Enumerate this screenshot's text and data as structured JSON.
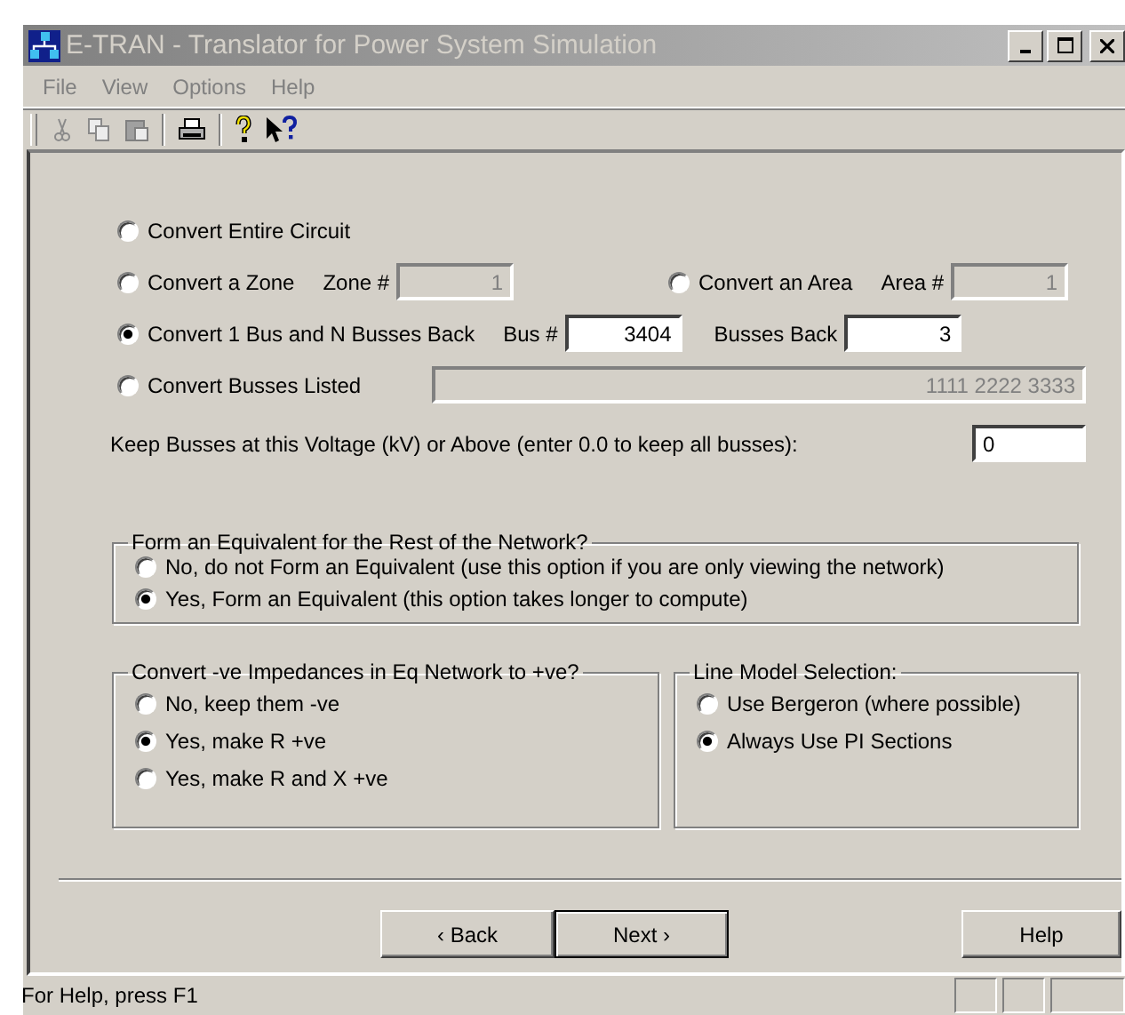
{
  "window": {
    "title": "E-TRAN - Translator for Power System Simulation"
  },
  "menu": [
    {
      "label": "File"
    },
    {
      "label": "View"
    },
    {
      "label": "Options"
    },
    {
      "label": "Help"
    }
  ],
  "conversion_rows": [
    [
      {
        "label": "Convert Entire Circuit",
        "selected": false
      }
    ],
    [
      {
        "label": "Convert a Zone",
        "selected": false,
        "fields": [
          {
            "label": "Zone #",
            "value": "1",
            "disabled": true
          }
        ]
      },
      {
        "label": "Convert an Area",
        "selected": false,
        "fields": [
          {
            "label": "Area #",
            "value": "1",
            "disabled": true
          }
        ]
      }
    ],
    [
      {
        "label": "Convert 1 Bus and N Busses Back",
        "selected": true,
        "fields": [
          {
            "label": "Bus #",
            "value": "3404",
            "disabled": false
          },
          {
            "label": "Busses Back",
            "value": "3",
            "disabled": false
          }
        ]
      }
    ],
    [
      {
        "label": "Convert Busses Listed",
        "selected": false,
        "fields": [
          {
            "kind": "wide",
            "value": "1111 2222 3333",
            "disabled": true
          }
        ]
      }
    ]
  ],
  "voltage": {
    "label": "Keep Busses at this Voltage (kV) or Above (enter 0.0 to keep all busses):",
    "value": "0"
  },
  "equivalent_group": {
    "title": "Form an Equivalent for the Rest of the Network?",
    "options": [
      {
        "label": "No, do not Form an Equivalent (use this option if you are only viewing the network)",
        "selected": false
      },
      {
        "label": "Yes, Form an Equivalent (this option takes longer to compute)",
        "selected": true
      }
    ]
  },
  "impedance_group": {
    "title": "Convert -ve Impedances in Eq Network to +ve?",
    "options": [
      {
        "label": "No, keep them -ve",
        "selected": false
      },
      {
        "label": "Yes, make R +ve",
        "selected": true
      },
      {
        "label": "Yes, make R and X +ve",
        "selected": false
      }
    ]
  },
  "line_model_group": {
    "title": "Line Model Selection:",
    "options": [
      {
        "label": "Use Bergeron (where possible)",
        "selected": false
      },
      {
        "label": "Always Use PI Sections",
        "selected": true
      }
    ]
  },
  "buttons": [
    {
      "label": "‹ Back",
      "default": false
    },
    {
      "label": "Next ›",
      "default": true
    },
    {
      "label": "Help",
      "default": false
    }
  ],
  "status_bar": {
    "text": "For Help, press F1"
  }
}
